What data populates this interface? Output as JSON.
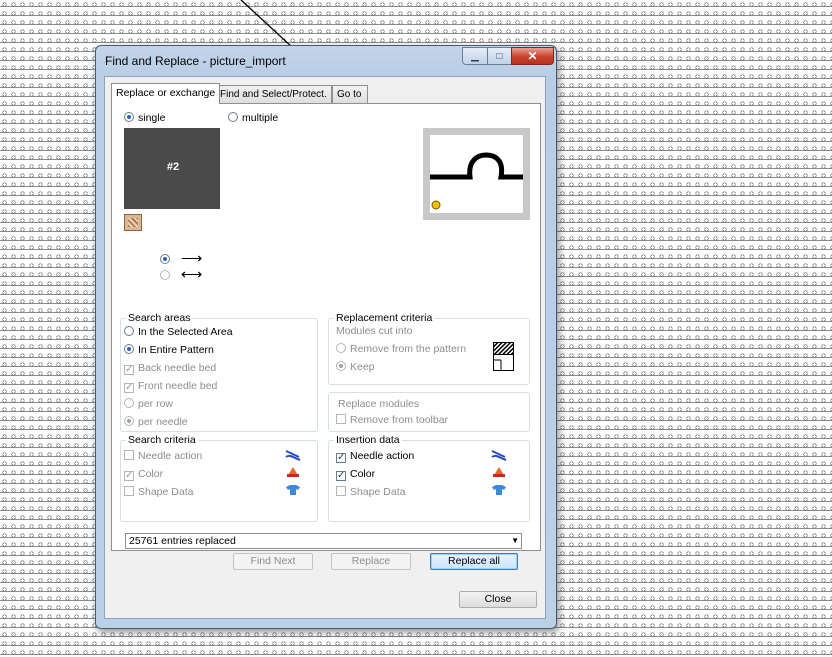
{
  "window": {
    "title": "Find and Replace - picture_import",
    "minimize_symbol": "▁",
    "maximize_symbol": "□",
    "close_symbol": "✕"
  },
  "tabs": [
    {
      "label": "Replace or exchange",
      "active": true
    },
    {
      "label": "Find and Select/Protect.",
      "active": false
    },
    {
      "label": "Go to",
      "active": false
    }
  ],
  "mode": {
    "single_label": "single",
    "multiple_label": "multiple",
    "selected": "single"
  },
  "preview": {
    "find_label": "#2"
  },
  "search_areas": {
    "title": "Search areas",
    "in_selected_area": "In the Selected Area",
    "in_entire_pattern": "In Entire Pattern",
    "back_needle_bed": "Back needle bed",
    "front_needle_bed": "Front needle bed",
    "per_row": "per row",
    "per_needle": "per needle"
  },
  "replacement_criteria": {
    "title": "Replacement criteria",
    "modules_cut_into": "Modules cut into",
    "remove_from_pattern": "Remove from the pattern",
    "keep": "Keep"
  },
  "replace_modules": {
    "title": "Replace modules",
    "remove_from_toolbar": "Remove from toolbar"
  },
  "search_criteria": {
    "title": "Search criteria",
    "needle_action": "Needle action",
    "color": "Color",
    "shape_data": "Shape Data"
  },
  "insertion_data": {
    "title": "Insertion data",
    "needle_action": "Needle action",
    "color": "Color",
    "shape_data": "Shape Data"
  },
  "status": {
    "entries_replaced": "25761 entries replaced",
    "dropdown_arrow": "▼"
  },
  "buttons": {
    "find_next": "Find Next",
    "replace": "Replace",
    "replace_all": "Replace all",
    "close": "Close"
  },
  "icons": {
    "check_mark": "✓",
    "arrow_right": "⟶",
    "arrow_both": "⟷"
  },
  "colors": {
    "title_bar": "#bcd0e8",
    "close_button": "#c8412c",
    "selection_blue": "#2c5fbf"
  }
}
